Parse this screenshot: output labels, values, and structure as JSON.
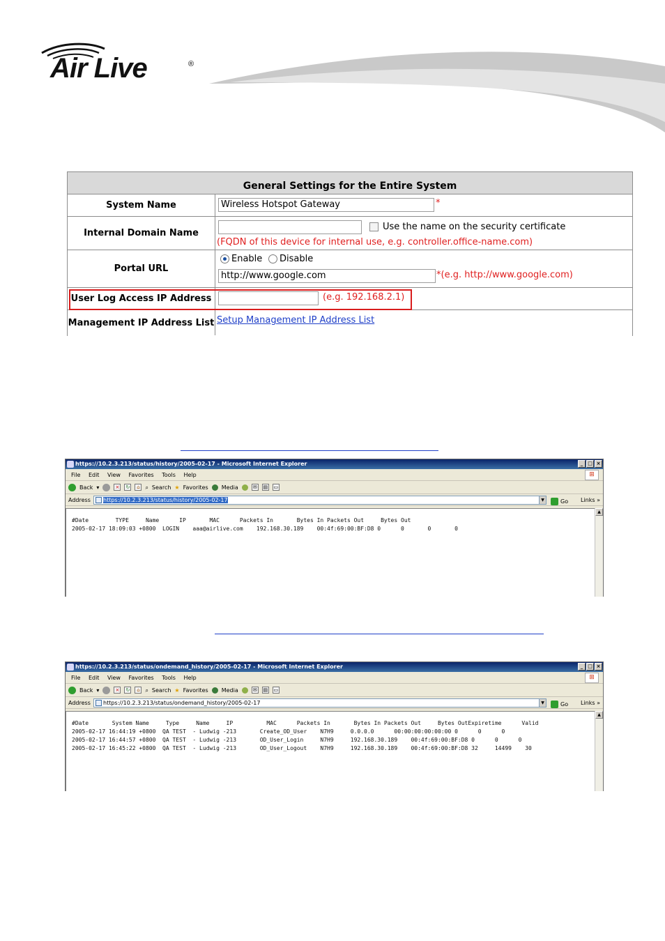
{
  "brand": {
    "name": "Air Live",
    "reg_mark": "®"
  },
  "settings": {
    "title": "General Settings for the Entire System",
    "system_name": {
      "label": "System Name",
      "value": "Wireless Hotspot Gateway",
      "required": "*"
    },
    "internal_domain": {
      "label": "Internal Domain Name",
      "value": "",
      "checkbox_label": "Use the name on the security certificate",
      "hint": "(FQDN of this device for internal use, e.g. controller.office-name.com)"
    },
    "portal_url": {
      "label": "Portal URL",
      "enable": "Enable",
      "disable": "Disable",
      "selected": "Enable",
      "value": "http://www.google.com",
      "hint": "*(e.g. http://www.google.com)"
    },
    "user_log": {
      "label": "User Log Access IP Address",
      "value": "",
      "hint": "(e.g. 192.168.2.1)"
    },
    "mgmt_ip": {
      "label": "Management IP Address List",
      "link": "Setup Management IP Address List"
    }
  },
  "ie_common": {
    "menu": [
      "File",
      "Edit",
      "View",
      "Favorites",
      "Tools",
      "Help"
    ],
    "toolbar": {
      "back": "Back",
      "search": "Search",
      "favorites": "Favorites",
      "media": "Media"
    },
    "address_label": "Address",
    "go": "Go",
    "links": "Links",
    "winbtns": [
      "_",
      "□",
      "×"
    ]
  },
  "window1": {
    "title": "https://10.2.3.213/status/history/2005-02-17 - Microsoft Internet Explorer",
    "address": "https://10.2.3.213/status/history/2005-02-17",
    "header": "#Date        TYPE     Name      IP       MAC      Packets In       Bytes In Packets Out     Bytes Out",
    "rows": [
      "2005-02-17 18:09:03 +0800  LOGIN    aaa@airlive.com    192.168.30.189    00:4f:69:00:BF:D8 0      0       0       0"
    ]
  },
  "window2": {
    "title": "https://10.2.3.213/status/ondemand_history/2005-02-17 - Microsoft Internet Explorer",
    "address": "https://10.2.3.213/status/ondemand_history/2005-02-17",
    "header": "#Date       System Name     Type     Name     IP          MAC      Packets In       Bytes In Packets Out     Bytes OutExpiretime      Valid",
    "rows": [
      "2005-02-17 16:44:19 +0800  QA TEST  - Ludwig -213       Create_OD_User    N7H9     0.0.0.0      00:00:00:00:00:00 0      0      0",
      "2005-02-17 16:44:57 +0800  QA TEST  - Ludwig -213       OD_User_Login     N7H9     192.168.30.189    00:4f:69:00:BF:D8 0      0      0",
      "2005-02-17 16:45:22 +0800  QA TEST  - Ludwig -213       OD_User_Logout    N7H9     192.168.30.189    00:4f:69:00:BF:D8 32     14499    30"
    ]
  }
}
